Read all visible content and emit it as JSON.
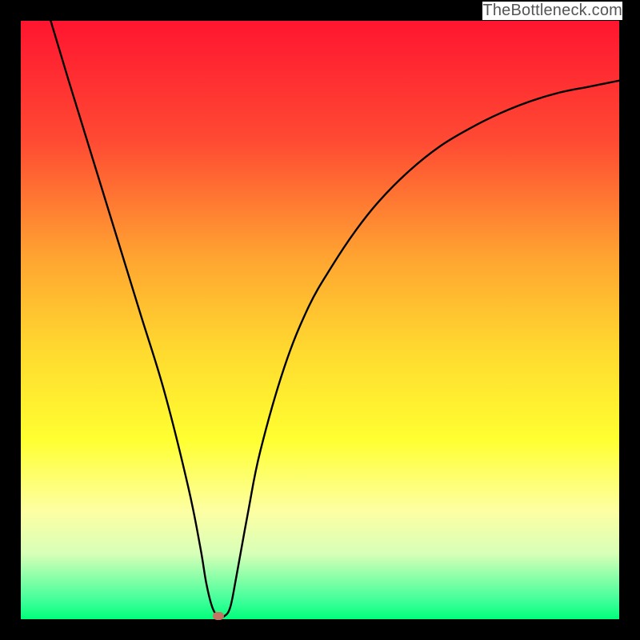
{
  "attribution": "TheBottleneck.com",
  "chart_data": {
    "type": "line",
    "title": "",
    "xlabel": "",
    "ylabel": "",
    "xlim": [
      0,
      100
    ],
    "ylim": [
      0,
      100
    ],
    "grid": false,
    "legend": false,
    "background": {
      "type": "vertical_gradient",
      "stops": [
        {
          "pos": 0.0,
          "color": "#ff1530"
        },
        {
          "pos": 0.2,
          "color": "#ff4a33"
        },
        {
          "pos": 0.4,
          "color": "#ffa631"
        },
        {
          "pos": 0.55,
          "color": "#ffd92f"
        },
        {
          "pos": 0.7,
          "color": "#ffff31"
        },
        {
          "pos": 0.82,
          "color": "#fdffa3"
        },
        {
          "pos": 0.89,
          "color": "#d8ffb8"
        },
        {
          "pos": 0.97,
          "color": "#3dff99"
        },
        {
          "pos": 1.0,
          "color": "#00ff7a"
        }
      ]
    },
    "series": [
      {
        "name": "bottleneck-curve",
        "color": "#000000",
        "x": [
          5,
          8,
          12,
          16,
          20,
          24,
          28,
          30,
          31,
          32,
          33,
          34,
          35,
          36,
          38,
          40,
          44,
          48,
          52,
          56,
          60,
          65,
          70,
          75,
          80,
          85,
          90,
          95,
          100
        ],
        "y": [
          100,
          90,
          77,
          64,
          51,
          38,
          22,
          12,
          6,
          2,
          0.5,
          0.5,
          2,
          7,
          18,
          28,
          42,
          52,
          59,
          65,
          70,
          75,
          79,
          82,
          84.5,
          86.5,
          88,
          89,
          90
        ]
      }
    ],
    "marker": {
      "name": "optimal-point",
      "x": 33,
      "y": 0.5,
      "color": "#c47463"
    },
    "frame": {
      "color": "#000000",
      "thickness": 26
    }
  }
}
